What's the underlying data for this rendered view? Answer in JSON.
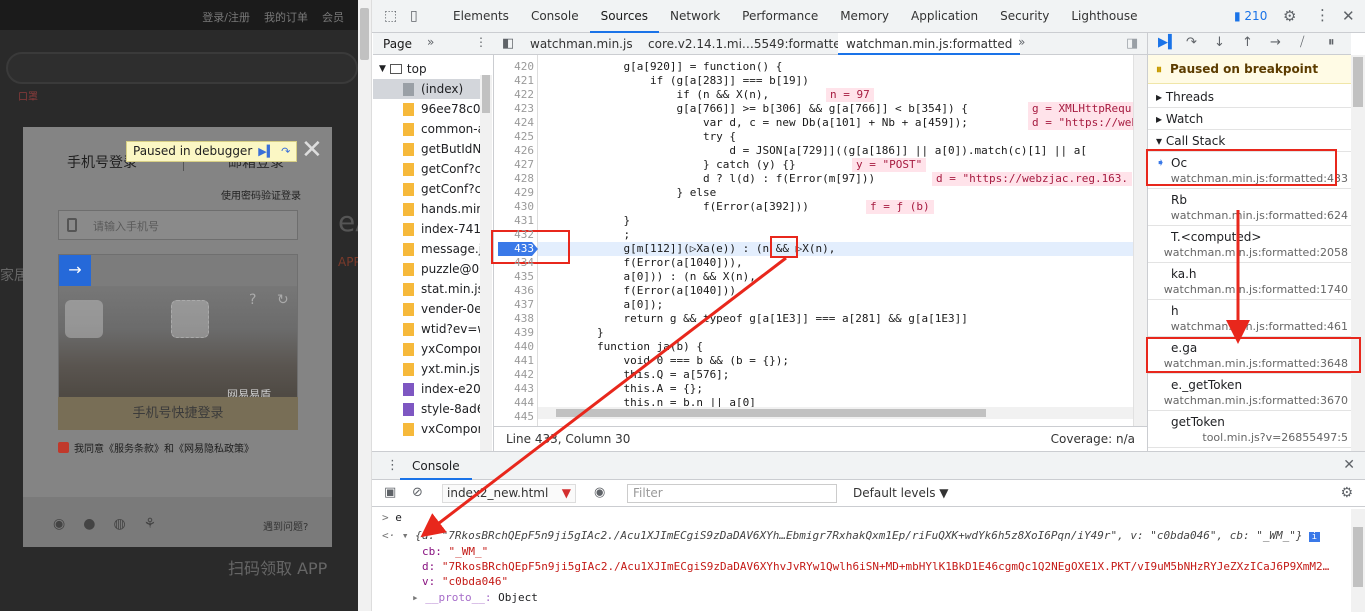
{
  "page": {
    "top_links": [
      "登录/注册",
      "我的订单",
      "会员"
    ],
    "bg_red_text": "口罩",
    "bg_big_text": "eA",
    "bg_side_text": "家居",
    "bg_app_text": "扫码领取 APP",
    "bg_app2": "APP"
  },
  "login": {
    "tab_phone": "手机号登录",
    "tab_email": "邮箱登录",
    "password_link": "使用密码验证登录",
    "phone_placeholder": "请输入手机号",
    "captcha_logo": "网易易盾",
    "quick_login": "手机号快捷登录",
    "agree_text": "我同意《服务条款》和《网易隐私政策》",
    "help_link": "遇到问题?"
  },
  "paused_overlay": {
    "label": "Paused in debugger"
  },
  "devtools": {
    "tabs": [
      "Elements",
      "Console",
      "Sources",
      "Network",
      "Performance",
      "Memory",
      "Application",
      "Security",
      "Lighthouse"
    ],
    "active_tab": "Sources",
    "issues_count": "210",
    "navigator": {
      "tab": "Page",
      "top": "top",
      "items": [
        {
          "label": "(index)",
          "icon": "file-gray-icon",
          "selected": true
        },
        {
          "label": "96ee78c0c",
          "icon": "file-yellow-icon"
        },
        {
          "label": "common-a",
          "icon": "file-yellow-icon"
        },
        {
          "label": "getButIdN",
          "icon": "file-yellow-icon"
        },
        {
          "label": "getConf?c",
          "icon": "file-yellow-icon"
        },
        {
          "label": "getConf?c",
          "icon": "file-yellow-icon"
        },
        {
          "label": "hands.min",
          "icon": "file-yellow-icon"
        },
        {
          "label": "index-741",
          "icon": "file-yellow-icon"
        },
        {
          "label": "message.js",
          "icon": "file-yellow-icon"
        },
        {
          "label": "puzzle@00",
          "icon": "file-yellow-icon"
        },
        {
          "label": "stat.min.js",
          "icon": "file-yellow-icon"
        },
        {
          "label": "vender-0e",
          "icon": "file-yellow-icon"
        },
        {
          "label": "wtid?ev=w",
          "icon": "file-yellow-icon"
        },
        {
          "label": "yxCompor",
          "icon": "file-yellow-icon"
        },
        {
          "label": "yxt.min.js?",
          "icon": "file-yellow-icon"
        },
        {
          "label": "index-e204",
          "icon": "file-purple-icon"
        },
        {
          "label": "style-8ad6",
          "icon": "file-purple-icon"
        },
        {
          "label": "vxCompor",
          "icon": "file-yellow-icon"
        }
      ]
    },
    "editor_tabs": [
      "watchman.min.js",
      "core.v2.14.1.mi…5549:formatted",
      "watchman.min.js:formatted"
    ],
    "active_editor_tab": "watchman.min.js:formatted",
    "lines": [
      {
        "n": "420",
        "text": "            g[a[920]] = function() {"
      },
      {
        "n": "421",
        "text": "                if (g[a[283]] === b[19])"
      },
      {
        "n": "422",
        "text": "                    if (n && X(n),"
      },
      {
        "n": "423",
        "text": "                    g[a[766]] >= b[306] && g[a[766]] < b[354]) {"
      },
      {
        "n": "424",
        "text": "                        var d, c = new Db(a[101] + Nb + a[459]);"
      },
      {
        "n": "425",
        "text": "                        try {"
      },
      {
        "n": "426",
        "text": "                            d = JSON[a[729]]((g[a[186]] || a[0]).match(c)[1] || a["
      },
      {
        "n": "427",
        "text": "                        } catch (y) {}"
      },
      {
        "n": "428",
        "text": "                        d ? l(d) : f(Error(m[97]))"
      },
      {
        "n": "429",
        "text": "                    } else"
      },
      {
        "n": "430",
        "text": "                        f(Error(a[392]))"
      },
      {
        "n": "431",
        "text": "            }"
      },
      {
        "n": "432",
        "text": "            ;"
      },
      {
        "n": "433",
        "text": "            g[m[112]](▷Xa(e)) : (n && ▷X(n),"
      },
      {
        "n": "434",
        "text": "            f(Error(a[1040])),"
      },
      {
        "n": "435",
        "text": "            a[0])) : (n && X(n),"
      },
      {
        "n": "436",
        "text": "            f(Error(a[1040])),"
      },
      {
        "n": "437",
        "text": "            a[0]);"
      },
      {
        "n": "438",
        "text": "            return g && typeof g[a[1E3]] === a[281] && g[a[1E3]]"
      },
      {
        "n": "439",
        "text": "        }"
      },
      {
        "n": "440",
        "text": "        function ja(b) {"
      },
      {
        "n": "441",
        "text": "            void 0 === b && (b = {});"
      },
      {
        "n": "442",
        "text": "            this.Q = a[576];"
      },
      {
        "n": "443",
        "text": "            this.A = {};"
      },
      {
        "n": "444",
        "text": "            this.n = b.n || a[0]"
      },
      {
        "n": "445",
        "text": ""
      }
    ],
    "inline_values": {
      "n97": "n = 97",
      "xhr": "g = XMLHttpRequ",
      "durl": "d = \"https://web",
      "ypost": "y = \"POST\"",
      "durl2": "d = \"https://webzjac.reg.163.",
      "ffn": "f = ƒ (b)"
    },
    "status_position": "Line 433, Column 30",
    "status_coverage": "Coverage: n/a",
    "debugger": {
      "paused_label": "Paused on breakpoint",
      "threads": "Threads",
      "watch": "Watch",
      "call_stack": "Call Stack",
      "frames": [
        {
          "fn": "Oc",
          "loc": "watchman.min.js:formatted:433",
          "current": true
        },
        {
          "fn": "Rb",
          "loc": "watchman.min.js:formatted:624"
        },
        {
          "fn": "T.<computed>",
          "loc": "watchman.min.js:formatted:2058"
        },
        {
          "fn": "ka.h",
          "loc": "watchman.min.js:formatted:1740"
        },
        {
          "fn": "h",
          "loc": "watchman.min.js:formatted:461"
        },
        {
          "fn": "e.ga",
          "loc": "watchman.min.js:formatted:3648"
        },
        {
          "fn": "e._getToken",
          "loc": "watchman.min.js:formatted:3670"
        },
        {
          "fn": "getToken",
          "loc": "tool.min.js?v=26855497:5"
        }
      ]
    },
    "console": {
      "tab": "Console",
      "context": "index2_new.html",
      "filter_placeholder": "Filter",
      "levels": "Default levels ▼",
      "input_line": "e",
      "summary": "{d: \"7RkosBRchQEpF5n9ji5gIAc2./Acu1XJImECgiS9zDaDAV6XYh…Ebmigr7RxhakQxm1Ep/riFuQXK+wdYk6h5z8XoI6Pqn/iY49r\", v: \"c0bda046\", cb: \"_WM_\"}",
      "cb_key": "cb:",
      "cb_val": "\"_WM_\"",
      "d_key": "d:",
      "d_val": "\"7RkosBRchQEpF5n9ji5gIAc2./Acu1XJImECgiS9zDaDAV6XYhvJvRYw1Qwlh6iSN+MD+mbHYlK1BkD1E46cgmQc1Q2NEgOXE1X.PKT/vI9uM5bNHzRYJeZXzICaJ6P9XmM2…",
      "v_key": "v:",
      "v_val": "\"c0bda046\"",
      "proto_key": "__proto__:",
      "proto_val": "Object"
    }
  },
  "colors": {
    "accent": "#1a73e8",
    "annotation": "#e8271c",
    "breakpoint": "#3a79e8"
  }
}
